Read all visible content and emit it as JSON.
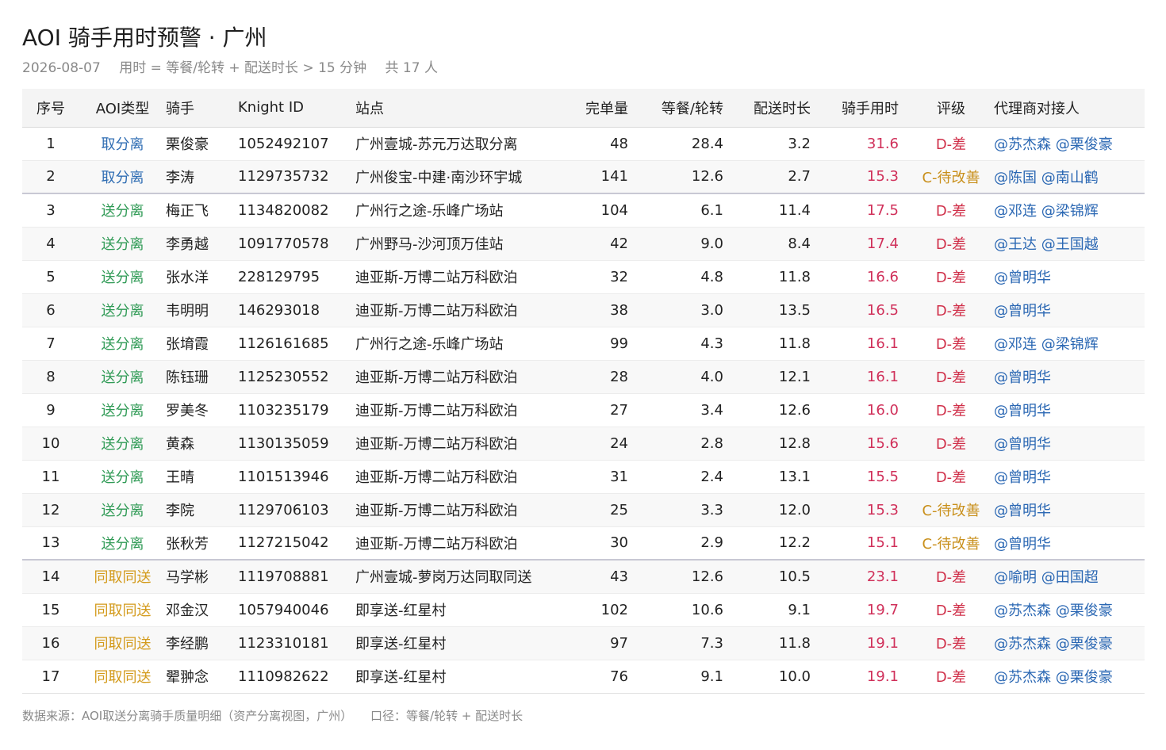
{
  "header": {
    "title": "AOI 骑手用时预警 · 广州",
    "date": "2026-08-07",
    "metric": "用时 = 等餐/轮转 + 配送时长 > 15 分钟",
    "count": "共 17 人"
  },
  "columns": [
    "序号",
    "AOI类型",
    "骑手",
    "Knight ID",
    "站点",
    "完单量",
    "等餐/轮转",
    "配送时长",
    "骑手用时",
    "评级",
    "代理商对接人"
  ],
  "rows": [
    {
      "no": "1",
      "type": "取分离",
      "rider": "栗俊豪",
      "knight_id": "1052492107",
      "station": "广州壹城-苏元万达取分离",
      "orders": "48",
      "wait": "28.4",
      "delivery": "3.2",
      "rider_time": "31.6",
      "grade": "D-差",
      "contact": "@苏杰森 @栗俊豪"
    },
    {
      "no": "2",
      "type": "取分离",
      "rider": "李涛",
      "knight_id": "1129735732",
      "station": "广州俊宝-中建·南沙环宇城",
      "orders": "141",
      "wait": "12.6",
      "delivery": "2.7",
      "rider_time": "15.3",
      "grade": "C-待改善",
      "contact": "@陈国 @南山鹤"
    },
    {
      "no": "3",
      "type": "送分离",
      "rider": "梅正飞",
      "knight_id": "1134820082",
      "station": "广州行之途-乐峰广场站",
      "orders": "104",
      "wait": "6.1",
      "delivery": "11.4",
      "rider_time": "17.5",
      "grade": "D-差",
      "contact": "@邓连 @梁锦辉"
    },
    {
      "no": "4",
      "type": "送分离",
      "rider": "李勇越",
      "knight_id": "1091770578",
      "station": "广州野马-沙河顶万佳站",
      "orders": "42",
      "wait": "9.0",
      "delivery": "8.4",
      "rider_time": "17.4",
      "grade": "D-差",
      "contact": "@王达 @王国越"
    },
    {
      "no": "5",
      "type": "送分离",
      "rider": "张水洋",
      "knight_id": "228129795",
      "station": "迪亚斯-万博二站万科欧泊",
      "orders": "32",
      "wait": "4.8",
      "delivery": "11.8",
      "rider_time": "16.6",
      "grade": "D-差",
      "contact": "@曾明华"
    },
    {
      "no": "6",
      "type": "送分离",
      "rider": "韦明明",
      "knight_id": "146293018",
      "station": "迪亚斯-万博二站万科欧泊",
      "orders": "38",
      "wait": "3.0",
      "delivery": "13.5",
      "rider_time": "16.5",
      "grade": "D-差",
      "contact": "@曾明华"
    },
    {
      "no": "7",
      "type": "送分离",
      "rider": "张堉霞",
      "knight_id": "1126161685",
      "station": "广州行之途-乐峰广场站",
      "orders": "99",
      "wait": "4.3",
      "delivery": "11.8",
      "rider_time": "16.1",
      "grade": "D-差",
      "contact": "@邓连 @梁锦辉"
    },
    {
      "no": "8",
      "type": "送分离",
      "rider": "陈钰珊",
      "knight_id": "1125230552",
      "station": "迪亚斯-万博二站万科欧泊",
      "orders": "28",
      "wait": "4.0",
      "delivery": "12.1",
      "rider_time": "16.1",
      "grade": "D-差",
      "contact": "@曾明华"
    },
    {
      "no": "9",
      "type": "送分离",
      "rider": "罗美冬",
      "knight_id": "1103235179",
      "station": "迪亚斯-万博二站万科欧泊",
      "orders": "27",
      "wait": "3.4",
      "delivery": "12.6",
      "rider_time": "16.0",
      "grade": "D-差",
      "contact": "@曾明华"
    },
    {
      "no": "10",
      "type": "送分离",
      "rider": "黄森",
      "knight_id": "1130135059",
      "station": "迪亚斯-万博二站万科欧泊",
      "orders": "24",
      "wait": "2.8",
      "delivery": "12.8",
      "rider_time": "15.6",
      "grade": "D-差",
      "contact": "@曾明华"
    },
    {
      "no": "11",
      "type": "送分离",
      "rider": "王晴",
      "knight_id": "1101513946",
      "station": "迪亚斯-万博二站万科欧泊",
      "orders": "31",
      "wait": "2.4",
      "delivery": "13.1",
      "rider_time": "15.5",
      "grade": "D-差",
      "contact": "@曾明华"
    },
    {
      "no": "12",
      "type": "送分离",
      "rider": "李院",
      "knight_id": "1129706103",
      "station": "迪亚斯-万博二站万科欧泊",
      "orders": "25",
      "wait": "3.3",
      "delivery": "12.0",
      "rider_time": "15.3",
      "grade": "C-待改善",
      "contact": "@曾明华"
    },
    {
      "no": "13",
      "type": "送分离",
      "rider": "张秋芳",
      "knight_id": "1127215042",
      "station": "迪亚斯-万博二站万科欧泊",
      "orders": "30",
      "wait": "2.9",
      "delivery": "12.2",
      "rider_time": "15.1",
      "grade": "C-待改善",
      "contact": "@曾明华"
    },
    {
      "no": "14",
      "type": "同取同送",
      "rider": "马学彬",
      "knight_id": "1119708881",
      "station": "广州壹城-萝岗万达同取同送",
      "orders": "43",
      "wait": "12.6",
      "delivery": "10.5",
      "rider_time": "23.1",
      "grade": "D-差",
      "contact": "@喻明 @田国超"
    },
    {
      "no": "15",
      "type": "同取同送",
      "rider": "邓金汉",
      "knight_id": "1057940046",
      "station": "即享送-红星村",
      "orders": "102",
      "wait": "10.6",
      "delivery": "9.1",
      "rider_time": "19.7",
      "grade": "D-差",
      "contact": "@苏杰森 @栗俊豪"
    },
    {
      "no": "16",
      "type": "同取同送",
      "rider": "李经鹏",
      "knight_id": "1123310181",
      "station": "即享送-红星村",
      "orders": "97",
      "wait": "7.3",
      "delivery": "11.8",
      "rider_time": "19.1",
      "grade": "D-差",
      "contact": "@苏杰森 @栗俊豪"
    },
    {
      "no": "17",
      "type": "同取同送",
      "rider": "翚翀念",
      "knight_id": "1110982622",
      "station": "即享送-红星村",
      "orders": "76",
      "wait": "9.1",
      "delivery": "10.0",
      "rider_time": "19.1",
      "grade": "D-差",
      "contact": "@苏杰森 @栗俊豪"
    }
  ],
  "footer": {
    "source": "数据来源：AOI取送分离骑手质量明细（资产分离视图，广州）",
    "definition": "口径：等餐/轮转 + 配送时长"
  },
  "colors": {
    "type_取分离": "#2f6db3",
    "type_送分离": "#2f9a55",
    "type_同取同送": "#d39a1a",
    "rider_time": "#d0305a",
    "grade_D": "#d0304a",
    "grade_C": "#c9901c",
    "contact": "#2a67b3"
  }
}
